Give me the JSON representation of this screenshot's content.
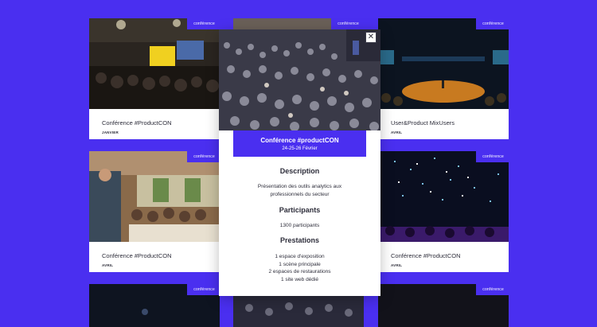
{
  "cards": [
    {
      "tag": "conférence",
      "title": "Conférence #ProductCON",
      "sub": "JANVIER"
    },
    {
      "tag": "conférence",
      "title": "",
      "sub": ""
    },
    {
      "tag": "conférence",
      "title": "User&Product MixUsers",
      "sub": "AVRIL"
    },
    {
      "tag": "conférence",
      "title": "Conférence #ProductCON",
      "sub": "AVRIL"
    },
    {
      "tag": "conférence",
      "title": "Conférence #ProductCON",
      "sub": "AVRIL"
    },
    {
      "tag": "conférence"
    },
    {
      "tag": "conférence"
    }
  ],
  "modal": {
    "close_icon": "close-icon",
    "title": "Conférence #productCON",
    "dates": "24-25-26 Février",
    "description_heading": "Description",
    "description_line1": "Présentation des outils analytics aux",
    "description_line2": "professionnels du secteur",
    "participants_heading": "Participants",
    "participants_text": "1300 participants",
    "prestations_heading": "Prestations",
    "prestations": [
      "1 espace d'exposition",
      "1 scène principale",
      "2 espaces de restaurations",
      "1 site web dédié"
    ]
  },
  "colors": {
    "background": "#4a2ff0",
    "accent": "#4a2ff0",
    "text": "#2d2d3a"
  }
}
